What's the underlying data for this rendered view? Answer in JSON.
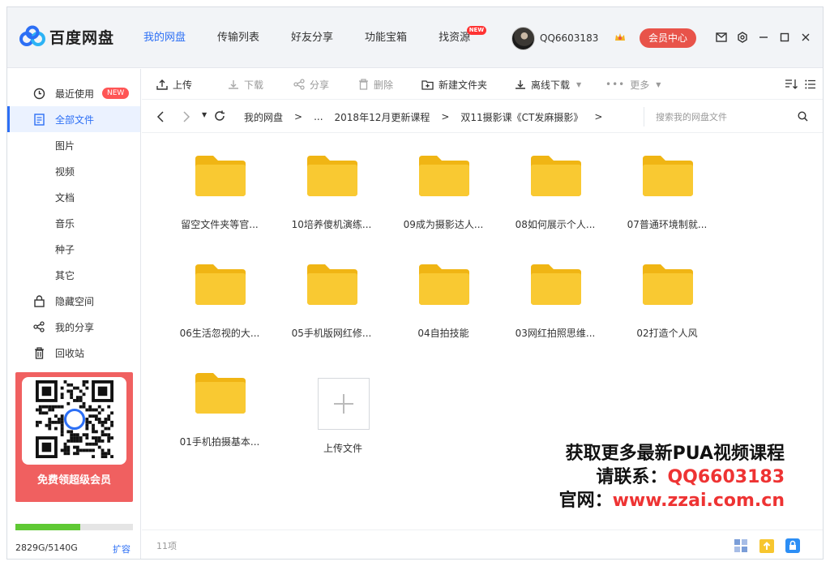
{
  "app": {
    "logo_text": "百度网盘"
  },
  "nav": [
    {
      "label": "我的网盘",
      "active": true
    },
    {
      "label": "传输列表"
    },
    {
      "label": "好友分享"
    },
    {
      "label": "功能宝箱"
    },
    {
      "label": "找资源",
      "badge": "NEW"
    }
  ],
  "user": {
    "name": "QQ6603183",
    "member_label": "会员中心"
  },
  "sidebar": {
    "items": [
      {
        "label": "最近使用",
        "badge": "NEW",
        "icon": "clock-icon"
      },
      {
        "label": "全部文件",
        "icon": "file-icon",
        "active": true
      },
      {
        "label": "图片"
      },
      {
        "label": "视频"
      },
      {
        "label": "文档"
      },
      {
        "label": "音乐"
      },
      {
        "label": "种子"
      },
      {
        "label": "其它"
      },
      {
        "label": "隐藏空间",
        "icon": "lock-icon"
      },
      {
        "label": "我的分享",
        "icon": "share-icon"
      },
      {
        "label": "回收站",
        "icon": "trash-icon"
      }
    ],
    "promo_text": "免费领超级会员",
    "storage": {
      "text": "2829G/5140G",
      "used_fraction": 0.55,
      "expand_label": "扩容"
    }
  },
  "toolbar": {
    "upload": "上传",
    "download": "下载",
    "share": "分享",
    "delete": "删除",
    "new_folder": "新建文件夹",
    "offline_download": "离线下载",
    "more": "更多"
  },
  "breadcrumb": [
    "我的网盘",
    ">",
    "...",
    "2018年12月更新课程",
    ">",
    "双11摄影课《CT发麻摄影》",
    ">"
  ],
  "search": {
    "placeholder": "搜索我的网盘文件"
  },
  "files": [
    "留空文件夹等官...",
    "10培养傻机演练...",
    "09成为摄影达人...",
    "08如何展示个人...",
    "07普通环境制就...",
    "06生活忽视的大...",
    "05手机版网红修...",
    "04自拍技能",
    "03网红拍照思维...",
    "02打造个人风",
    "01手机拍摄基本..."
  ],
  "upload_tile_label": "上传文件",
  "watermark": {
    "line1": "获取更多最新PUA视频课程",
    "line2_prefix": "请联系：",
    "line2_value": "QQ6603183",
    "line3_prefix": "官网：",
    "line3_value": "www.zzai.com.cn"
  },
  "status": {
    "count": "11项"
  },
  "colors": {
    "accent": "#2c6ff5",
    "folder": "#f7c62f",
    "member": "#e8534a"
  }
}
